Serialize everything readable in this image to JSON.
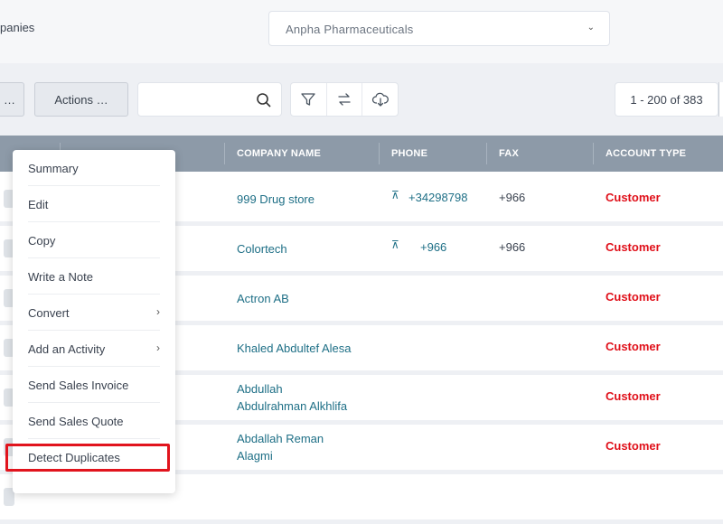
{
  "header": {
    "title": "panies",
    "company_select": "Anpha Pharmaceuticals"
  },
  "toolbar": {
    "prev_label": "…",
    "actions_label": "Actions …",
    "search_value": "",
    "pagination": "1 - 200 of 383"
  },
  "table": {
    "columns": [
      "COMPANY NAME",
      "PHONE",
      "FAX",
      "ACCOUNT TYPE"
    ],
    "rows": [
      {
        "company": "999 Drug store",
        "phone": "+34298798",
        "fax": "+966",
        "account_type": "Customer"
      },
      {
        "company": "Colortech",
        "phone": "+966",
        "fax": "+966",
        "account_type": "Customer"
      },
      {
        "company": "Actron AB",
        "phone": "",
        "fax": "",
        "account_type": "Customer"
      },
      {
        "company": "Khaled Abdultef Alesa",
        "phone": "",
        "fax": "",
        "account_type": "Customer"
      },
      {
        "company": "Abdullah Abdulrahman Alkhlifa",
        "company_line1": "Abdullah",
        "company_line2": "Abdulrahman Alkhlifa",
        "phone": "",
        "fax": "",
        "account_type": "Customer"
      },
      {
        "company": "Abdallah Reman Alagmi",
        "company_line1": "Abdallah Reman",
        "company_line2": "Alagmi",
        "phone": "",
        "fax": "",
        "account_type": "Customer"
      }
    ]
  },
  "menu": {
    "items": [
      {
        "label": "Summary"
      },
      {
        "label": "Edit"
      },
      {
        "label": "Copy"
      },
      {
        "label": "Write a Note"
      },
      {
        "label": "Convert",
        "arrow": "›"
      },
      {
        "label": "Add an Activity",
        "arrow": "›"
      },
      {
        "label": "Send Sales Invoice"
      },
      {
        "label": "Send Sales Quote"
      },
      {
        "label": "Detect Duplicates"
      }
    ]
  },
  "colors": {
    "accent_link": "#1e6f86",
    "account_type": "#e0101a",
    "header_bar": "#8d9aa8",
    "highlight": "#e1141d"
  }
}
